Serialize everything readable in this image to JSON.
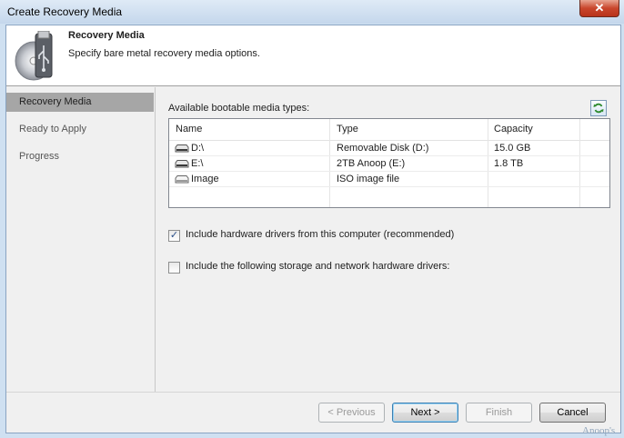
{
  "window": {
    "title": "Create Recovery Media",
    "close_glyph": "✕"
  },
  "header": {
    "title": "Recovery Media",
    "subtitle": "Specify bare metal recovery media options.",
    "icon": "usb-disc-icon"
  },
  "nav": {
    "items": [
      {
        "label": "Recovery Media",
        "active": true
      },
      {
        "label": "Ready to Apply",
        "active": false
      },
      {
        "label": "Progress",
        "active": false
      }
    ]
  },
  "media": {
    "label": "Available bootable media types:",
    "refresh_icon": "refresh-icon",
    "columns": [
      "Name",
      "Type",
      "Capacity"
    ],
    "rows": [
      {
        "name": "D:\\",
        "type": "Removable Disk (D:)",
        "capacity": "15.0 GB",
        "icon": "drive-icon"
      },
      {
        "name": "E:\\",
        "type": "2TB Anoop (E:)",
        "capacity": "1.8 TB",
        "icon": "drive-icon"
      },
      {
        "name": "Image",
        "type": "ISO image file",
        "capacity": "",
        "icon": "drive-icon"
      }
    ]
  },
  "options": {
    "include_drivers": {
      "label": "Include hardware drivers from this computer (recommended)",
      "checked": true
    },
    "include_storage": {
      "label": "Include the following storage and network hardware drivers:",
      "checked": false
    }
  },
  "buttons": {
    "previous": "< Previous",
    "next": "Next >",
    "finish": "Finish",
    "cancel": "Cancel"
  },
  "watermark": "Anoop's"
}
